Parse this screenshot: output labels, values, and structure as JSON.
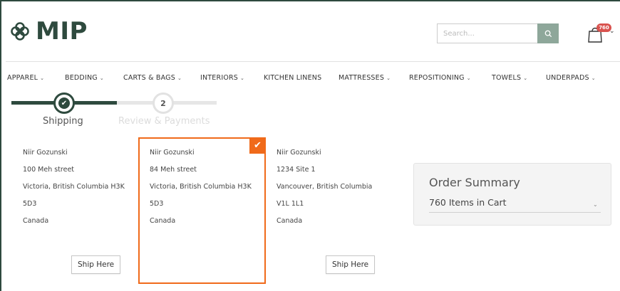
{
  "brand": {
    "logo_text": "MIP",
    "color": "#2e4a3e"
  },
  "search": {
    "placeholder": "Search..."
  },
  "cart": {
    "badge": "760"
  },
  "nav": {
    "items": [
      {
        "label": "APPAREL",
        "dropdown": true
      },
      {
        "label": "BEDDING",
        "dropdown": true
      },
      {
        "label": "CARTS & BAGS",
        "dropdown": true
      },
      {
        "label": "INTERIORS",
        "dropdown": true
      },
      {
        "label": "KITCHEN LINENS",
        "dropdown": false
      },
      {
        "label": "MATTRESSES",
        "dropdown": true
      },
      {
        "label": "REPOSITIONING",
        "dropdown": true
      },
      {
        "label": "TOWELS",
        "dropdown": true
      },
      {
        "label": "UNDERPADS",
        "dropdown": true
      }
    ]
  },
  "checkout_steps": {
    "step1": {
      "label": "Shipping",
      "status": "complete"
    },
    "step2": {
      "number": "2",
      "label": "Review & Payments",
      "status": "pending"
    }
  },
  "addresses": [
    {
      "name": "Niir Gozunski",
      "street": "100 Meh street",
      "city": "Victoria, British Columbia H3K",
      "postal": "5D3",
      "country": "Canada",
      "button": "Ship Here",
      "selected": false
    },
    {
      "name": "Niir Gozunski",
      "street": "84 Meh street",
      "city": "Victoria, British Columbia H3K",
      "postal": "5D3",
      "country": "Canada",
      "button": "",
      "selected": true
    },
    {
      "name": "Niir Gozunski",
      "street": "1234 Site 1",
      "city": "Vancouver, British Columbia",
      "postal": "V1L 1L1",
      "country": "Canada",
      "button": "Ship Here",
      "selected": false
    }
  ],
  "order_summary": {
    "title": "Order Summary",
    "items_in_cart": "760 Items in Cart"
  },
  "colors": {
    "accent_selected": "#f06a1a",
    "badge": "#d9534f",
    "search_button": "#8ea79a"
  }
}
